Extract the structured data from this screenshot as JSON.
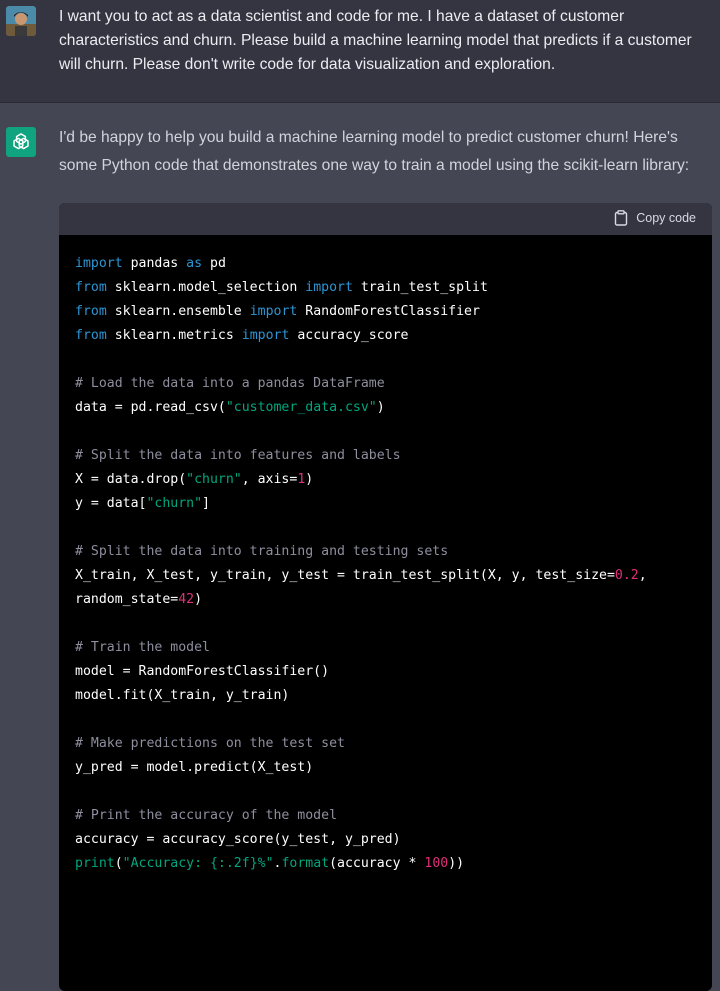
{
  "user": {
    "message": "I want you to act as a data scientist and code for me. I have a dataset of customer characteristics and churn. Please build a machine learning model that predicts if a customer will churn. Please don't write code for data visualization and exploration."
  },
  "assistant": {
    "intro": "I'd be happy to help you build a machine learning model to predict customer churn! Here's some Python code that demonstrates one way to train a model using the scikit-learn library:",
    "copy_label": "Copy code",
    "code": {
      "l1": [
        "import",
        " pandas ",
        "as",
        " pd"
      ],
      "l2": [
        "from",
        " sklearn.model_selection ",
        "import",
        " train_test_split"
      ],
      "l3": [
        "from",
        " sklearn.ensemble ",
        "import",
        " RandomForestClassifier"
      ],
      "l4": [
        "from",
        " sklearn.metrics ",
        "import",
        " accuracy_score"
      ],
      "c1": "# Load the data into a pandas DataFrame",
      "l5": [
        "data = pd.read_csv(",
        "\"customer_data.csv\"",
        ")"
      ],
      "c2": "# Split the data into features and labels",
      "l6": [
        "X = data.drop(",
        "\"churn\"",
        ", axis=",
        "1",
        ")"
      ],
      "l7": [
        "y = data[",
        "\"churn\"",
        "]"
      ],
      "c3": "# Split the data into training and testing sets",
      "l8": [
        "X_train, X_test, y_train, y_test = train_test_split(X, y, test_size=",
        "0.2",
        ","
      ],
      "l9": [
        "random_state=",
        "42",
        ")"
      ],
      "c4": "# Train the model",
      "l10": "model = RandomForestClassifier()",
      "l11": "model.fit(X_train, y_train)",
      "c5": "# Make predictions on the test set",
      "l12": "y_pred = model.predict(X_test)",
      "c6": "# Print the accuracy of the model",
      "l13": "accuracy = accuracy_score(y_test, y_pred)",
      "l14": [
        "print",
        "(",
        "\"Accuracy: {:.2f}%\"",
        ".",
        "format",
        "(accuracy * ",
        "100",
        "))"
      ]
    }
  },
  "colors": {
    "keyword": "#2e95d3",
    "string": "#00a67d",
    "number": "#df3079",
    "comment": "#8e8e9e",
    "brand": "#10a37f"
  }
}
